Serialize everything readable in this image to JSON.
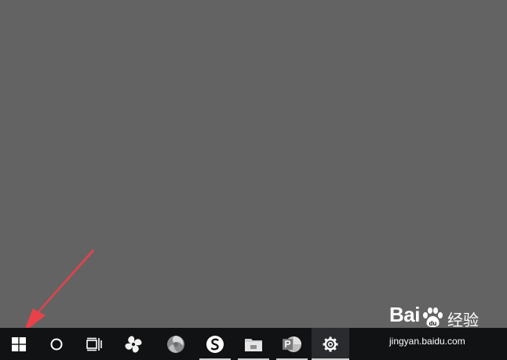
{
  "desktop": {
    "background": "#636363"
  },
  "taskbar": {
    "background": "#111214",
    "buttons": [
      {
        "name": "start-button",
        "icon": "windows-logo-icon",
        "running": false,
        "active": false
      },
      {
        "name": "search-button",
        "icon": "cortana-circle-icon",
        "running": false,
        "active": false
      },
      {
        "name": "task-view-button",
        "icon": "task-view-icon",
        "running": false,
        "active": false
      },
      {
        "name": "app-pinwheel-button",
        "icon": "pinwheel-app-icon",
        "running": false,
        "active": false
      },
      {
        "name": "app-swirl-button",
        "icon": "swirl-app-icon",
        "running": false,
        "active": false
      },
      {
        "name": "app-s-button",
        "icon": "s-app-icon",
        "running": true,
        "active": false
      },
      {
        "name": "app-folder-button",
        "icon": "folder-app-icon",
        "running": true,
        "active": false
      },
      {
        "name": "app-powerpoint-button",
        "icon": "powerpoint-icon",
        "running": true,
        "active": false
      },
      {
        "name": "settings-button",
        "icon": "gear-icon",
        "running": true,
        "active": true
      }
    ]
  },
  "annotation": {
    "arrow_color": "#e8414a"
  },
  "watermark": {
    "logo_text": "Bai",
    "brand_text": "经验",
    "url": "jingyan.baidu.com"
  }
}
